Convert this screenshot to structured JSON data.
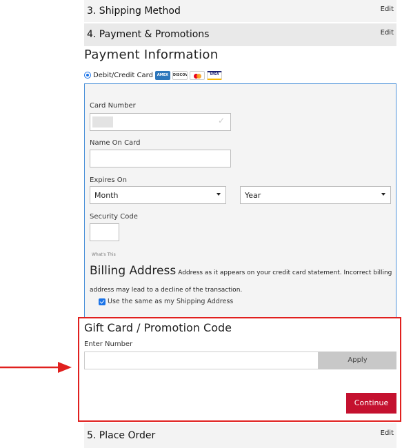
{
  "steps": {
    "shipping": {
      "title": "3. Shipping Method",
      "edit": "Edit"
    },
    "payment": {
      "title": "4. Payment & Promotions",
      "edit": "Edit"
    },
    "place_order": {
      "title": "5. Place Order",
      "edit": "Edit"
    }
  },
  "payment_info": {
    "title": "Payment Information",
    "method_label": "Debit/Credit Card",
    "card_logos": [
      "AMEX",
      "DISCOVER",
      "Mastercard",
      "VISA"
    ]
  },
  "card_form": {
    "card_number_label": "Card Number",
    "name_on_card_label": "Name On Card",
    "expires_on_label": "Expires On",
    "month_value": "Month",
    "year_value": "Year",
    "security_code_label": "Security Code",
    "whats_this": "What's This"
  },
  "billing": {
    "title": "Billing Address",
    "note": "Address as it appears on your credit card statement. Incorrect billing address may lead to a decline of the transaction.",
    "same_as_shipping": "Use the same as my Shipping Address",
    "same_as_shipping_checked": true
  },
  "gift_card": {
    "title": "Gift Card / Promotion Code",
    "input_label": "Enter Number",
    "input_value": "",
    "apply_label": "Apply",
    "continue_label": "Continue"
  },
  "colors": {
    "highlight_border": "#e0201e",
    "continue_button": "#c4112f",
    "panel_border": "#4a90d9",
    "radio_accent": "#1a73e8"
  }
}
